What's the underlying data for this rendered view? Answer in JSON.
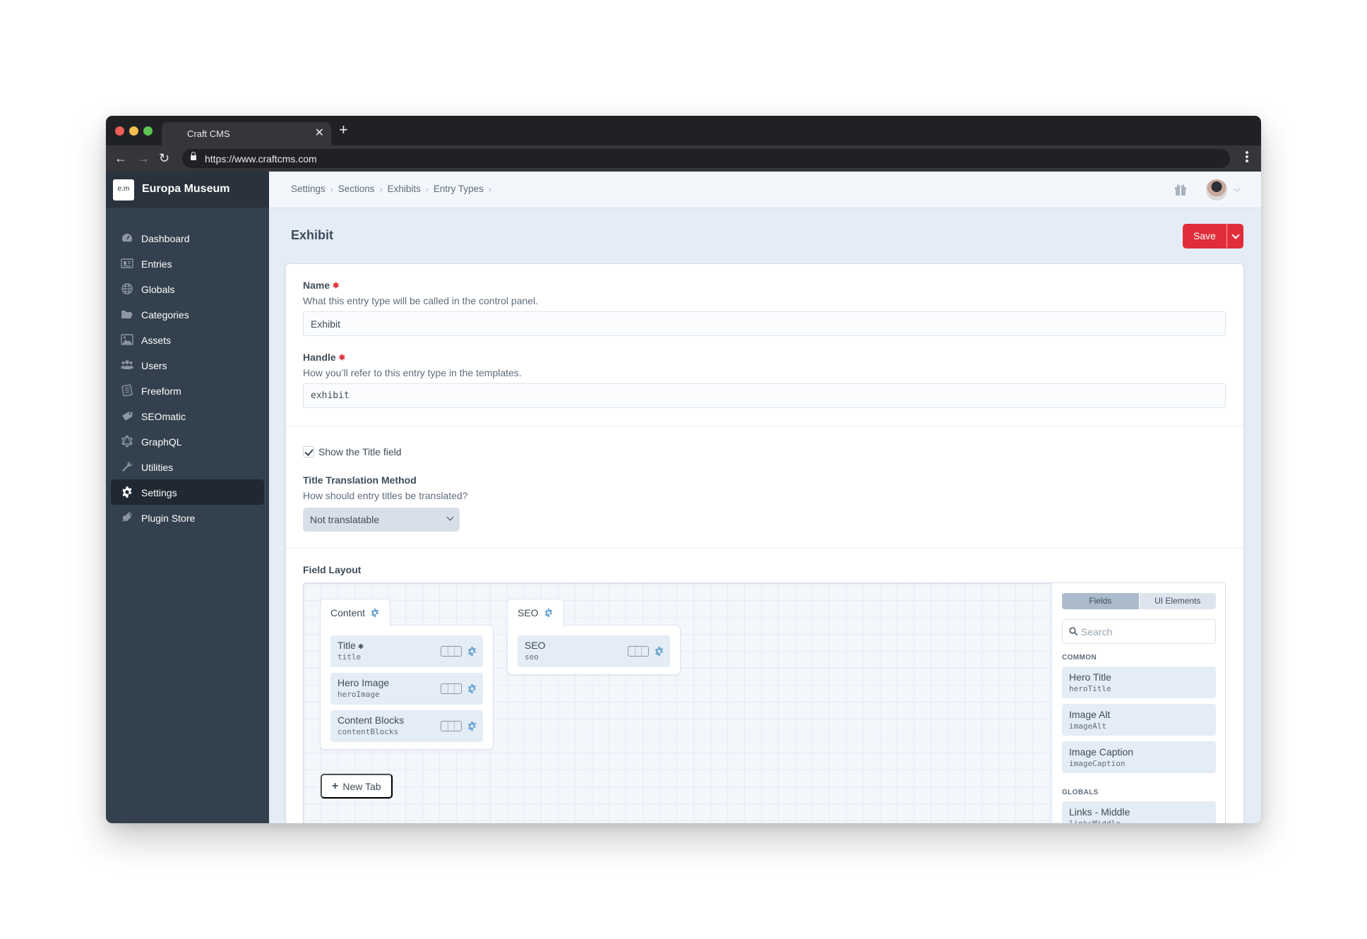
{
  "browser": {
    "tab_title": "Craft CMS",
    "url": "https://www.craftcms.com"
  },
  "brand": {
    "logo_text": "e.m",
    "name": "Europa Museum"
  },
  "sidebar": {
    "items": [
      {
        "label": "Dashboard",
        "icon": "dashboard-icon",
        "active": false
      },
      {
        "label": "Entries",
        "icon": "entries-icon",
        "active": false
      },
      {
        "label": "Globals",
        "icon": "globe-icon",
        "active": false
      },
      {
        "label": "Categories",
        "icon": "folder-icon",
        "active": false
      },
      {
        "label": "Assets",
        "icon": "image-icon",
        "active": false
      },
      {
        "label": "Users",
        "icon": "users-icon",
        "active": false
      },
      {
        "label": "Freeform",
        "icon": "freeform-icon",
        "active": false
      },
      {
        "label": "SEOmatic",
        "icon": "seo-tag-icon",
        "active": false
      },
      {
        "label": "GraphQL",
        "icon": "graphql-icon",
        "active": false
      },
      {
        "label": "Utilities",
        "icon": "wrench-icon",
        "active": false
      },
      {
        "label": "Settings",
        "icon": "gear-icon",
        "active": true
      },
      {
        "label": "Plugin Store",
        "icon": "plug-icon",
        "active": false
      }
    ]
  },
  "breadcrumbs": [
    "Settings",
    "Sections",
    "Exhibits",
    "Entry Types"
  ],
  "page": {
    "title": "Exhibit",
    "save_label": "Save"
  },
  "form": {
    "name": {
      "label": "Name",
      "instructions": "What this entry type will be called in the control panel.",
      "value": "Exhibit"
    },
    "handle": {
      "label": "Handle",
      "instructions": "How you’ll refer to this entry type in the templates.",
      "value": "exhibit"
    },
    "show_title": {
      "label": "Show the Title field",
      "checked": true
    },
    "title_translation": {
      "label": "Title Translation Method",
      "instructions": "How should entry titles be translated?",
      "selected": "Not translatable"
    },
    "field_layout": {
      "label": "Field Layout",
      "tabs": [
        {
          "name": "Content",
          "fields": [
            {
              "name": "Title",
              "handle": "title",
              "required": true
            },
            {
              "name": "Hero Image",
              "handle": "heroImage",
              "required": false
            },
            {
              "name": "Content Blocks",
              "handle": "contentBlocks",
              "required": false
            }
          ]
        },
        {
          "name": "SEO",
          "fields": [
            {
              "name": "SEO",
              "handle": "seo",
              "required": false
            }
          ]
        }
      ],
      "new_tab_label": "New Tab",
      "library": {
        "tabs": [
          "Fields",
          "UI Elements"
        ],
        "active_tab": "Fields",
        "search_placeholder": "Search",
        "groups": [
          {
            "name": "COMMON",
            "fields": [
              {
                "name": "Hero Title",
                "handle": "heroTitle"
              },
              {
                "name": "Image Alt",
                "handle": "imageAlt"
              },
              {
                "name": "Image Caption",
                "handle": "imageCaption"
              }
            ]
          },
          {
            "name": "GLOBALS",
            "fields": [
              {
                "name": "Links - Middle",
                "handle": "linksMiddle"
              }
            ]
          }
        ]
      }
    }
  },
  "colors": {
    "primary_red": "#e12d39",
    "sidebar_bg": "#33404d",
    "accent_gear": "#6aa4d3"
  }
}
